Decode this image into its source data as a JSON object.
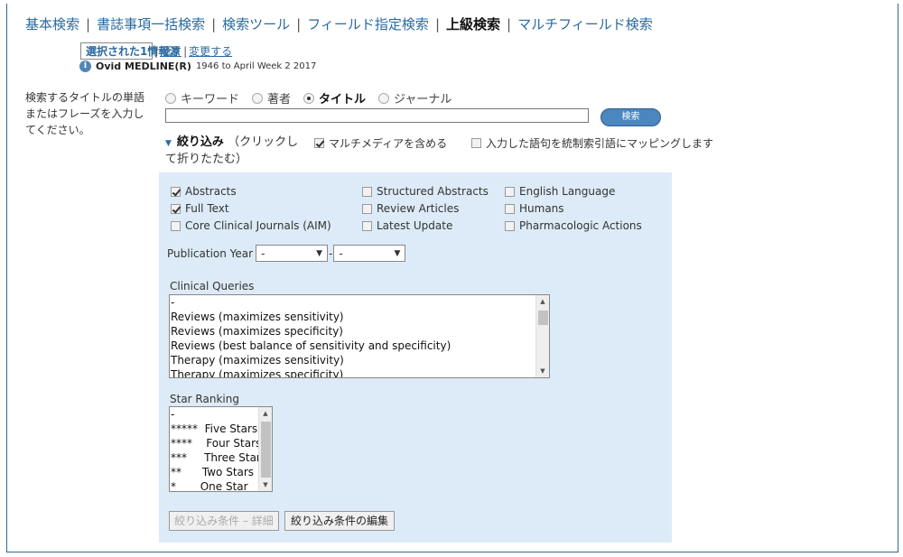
{
  "tabs": [
    {
      "label": "基本検索",
      "active": false
    },
    {
      "label": "書誌事項一括検索",
      "active": false
    },
    {
      "label": "検索ツール",
      "active": false
    },
    {
      "label": "フィールド指定検索",
      "active": false
    },
    {
      "label": "上級検索",
      "active": true
    },
    {
      "label": "マルチフィールド検索",
      "active": false
    }
  ],
  "source": {
    "selected_label": "選択された1情報源",
    "hide_link": "隠す",
    "change_link": "変更する",
    "db_name": "Ovid MEDLINE(R)",
    "db_range": "1946 to April Week 2 2017"
  },
  "search": {
    "prompt": "検索するタイトルの単語またはフレーズを入力してください。",
    "modes": [
      {
        "label": "キーワード",
        "checked": false
      },
      {
        "label": "著者",
        "checked": false
      },
      {
        "label": "タイトル",
        "checked": true
      },
      {
        "label": "ジャーナル",
        "checked": false
      }
    ],
    "input_value": "",
    "button_label": "検索"
  },
  "limits_toggle": {
    "label": "絞り込み",
    "hint": "（クリックして折りたたむ）"
  },
  "options": {
    "multimedia": {
      "label": "マルチメディアを含める",
      "checked": true
    },
    "map_terms": {
      "label": "入力した語句を統制索引語にマッピングします",
      "checked": false
    }
  },
  "limits": {
    "checkboxes": [
      {
        "label": "Abstracts",
        "checked": true
      },
      {
        "label": "Structured Abstracts",
        "checked": false
      },
      {
        "label": "English Language",
        "checked": false
      },
      {
        "label": "Full Text",
        "checked": true
      },
      {
        "label": "Review Articles",
        "checked": false
      },
      {
        "label": "Humans",
        "checked": false
      },
      {
        "label": "Core Clinical Journals (AIM)",
        "checked": false
      },
      {
        "label": "Latest Update",
        "checked": false
      },
      {
        "label": "Pharmacologic Actions",
        "checked": false
      }
    ],
    "pub_year": {
      "label": "Publication Year",
      "from": "-",
      "to": "-",
      "separator": "-"
    },
    "clinical_queries": {
      "label": "Clinical Queries",
      "options": [
        "-",
        "Reviews (maximizes sensitivity)",
        "Reviews (maximizes specificity)",
        "Reviews (best balance of sensitivity and specificity)",
        "Therapy (maximizes sensitivity)",
        "Therapy (maximizes specificity)"
      ]
    },
    "star_ranking": {
      "label": "Star Ranking",
      "options": [
        "-",
        "*****  Five Stars",
        "****    Four Stars",
        "***     Three Stars",
        "**      Two Stars",
        "*       One Star"
      ]
    },
    "buttons": {
      "additional": "絞り込み条件 – 詳細",
      "edit": "絞り込み条件の編集"
    }
  }
}
